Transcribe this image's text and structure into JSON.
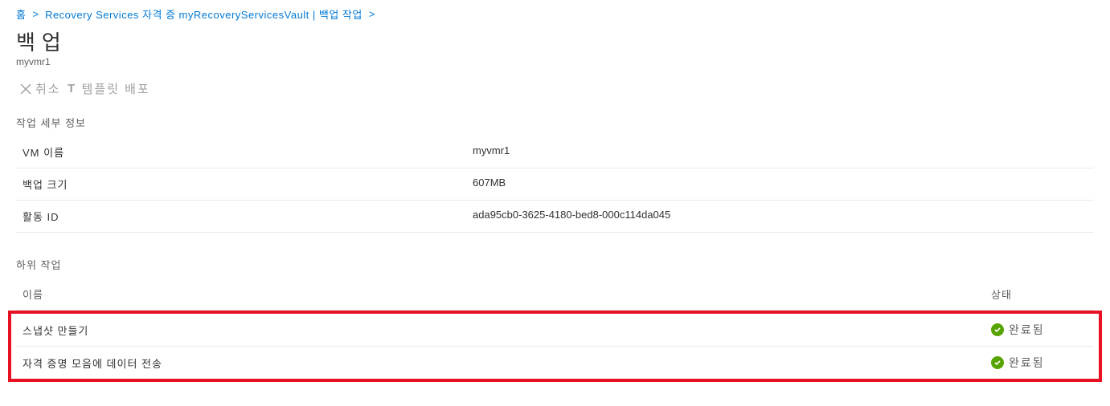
{
  "breadcrumb": {
    "items": [
      {
        "label": "홈"
      },
      {
        "label": "Recovery Services 자격 증"
      },
      {
        "label": "myRecoveryServicesVault | 백업 작업"
      }
    ]
  },
  "header": {
    "title": "백업",
    "subtitle": "myvmr1"
  },
  "toolbar": {
    "cancel_label": "취소",
    "template_label": "템플릿 배포"
  },
  "details": {
    "section_title": "작업 세부 정보",
    "rows": [
      {
        "label": "VM 이름",
        "value": "myvmr1"
      },
      {
        "label": "백업 크기",
        "value": "607MB"
      },
      {
        "label": "활동 ID",
        "value": "ada95cb0-3625-4180-bed8-000c114da045"
      }
    ]
  },
  "subtasks": {
    "section_title": "하위 작업",
    "headers": {
      "name": "이름",
      "status": "상태"
    },
    "rows": [
      {
        "name": "스냅샷 만들기",
        "status": "완료됨"
      },
      {
        "name": "자격 증명 모음에 데이터 전송",
        "status": "완료됨"
      }
    ]
  }
}
